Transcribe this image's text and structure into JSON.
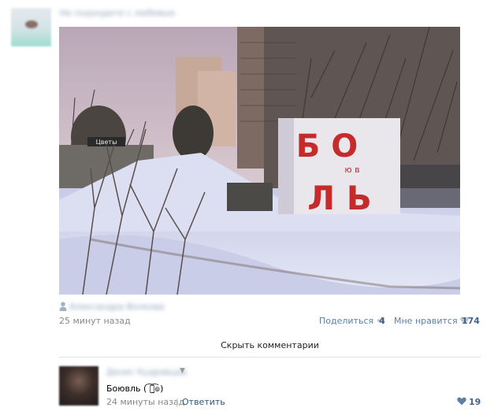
{
  "post": {
    "author_name_blurred": "Не подходите с любовью",
    "photo": {
      "sign_letters_top": "Б  О",
      "sign_letters_mid": "ю  в",
      "sign_letters_bottom": "Л  Ь",
      "shop_sign": "Цветы"
    },
    "photo_author_blurred": "Александра Волкова",
    "time": "25 минут назад",
    "share_label": "Поделиться",
    "share_count": "4",
    "like_label": "Мне нравится",
    "like_count": "174",
    "hide_comments_label": "Скрыть комментарии"
  },
  "comment": {
    "author_name_blurred": "Денис Кудрявцев",
    "caret": "▼",
    "text": "Боювль ( ͡๏̯͡๏)",
    "time": "24 минуты назад",
    "separator": "|",
    "reply_label": "Ответить",
    "like_count": "19"
  },
  "colors": {
    "link": "#2b587a",
    "count": "#42648b",
    "sign_red": "#c62b2b",
    "divider": "#dfe5eb"
  }
}
